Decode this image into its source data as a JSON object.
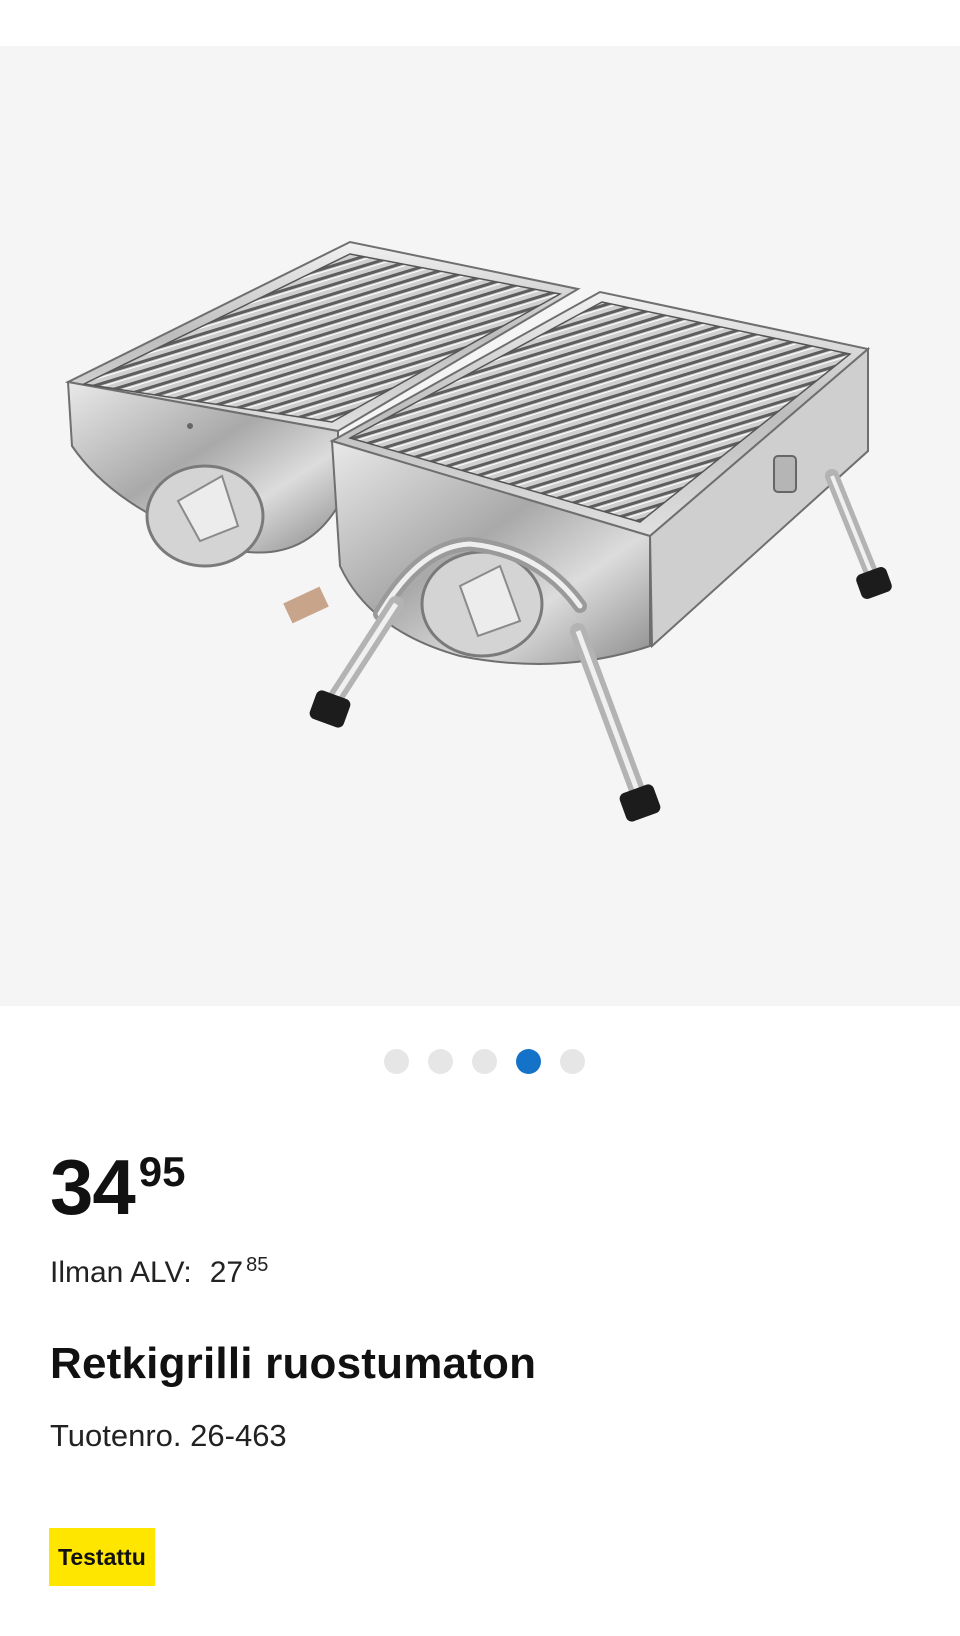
{
  "gallery": {
    "image_alt": "Retkigrilli ruostumaton",
    "dot_count": 5,
    "active_index": 3,
    "colors": {
      "background": "#f5f5f5",
      "dot": "#e6e6e6",
      "dot_active": "#1572c9"
    }
  },
  "product": {
    "price": {
      "whole": "34",
      "cents": "95"
    },
    "ex_vat": {
      "label": "Ilman ALV:",
      "whole": "27",
      "cents": "85"
    },
    "title": "Retkigrilli ruostumaton",
    "sku": "Tuotenro. 26-463",
    "badge": "Testattu",
    "badge_color": "#ffe600"
  }
}
